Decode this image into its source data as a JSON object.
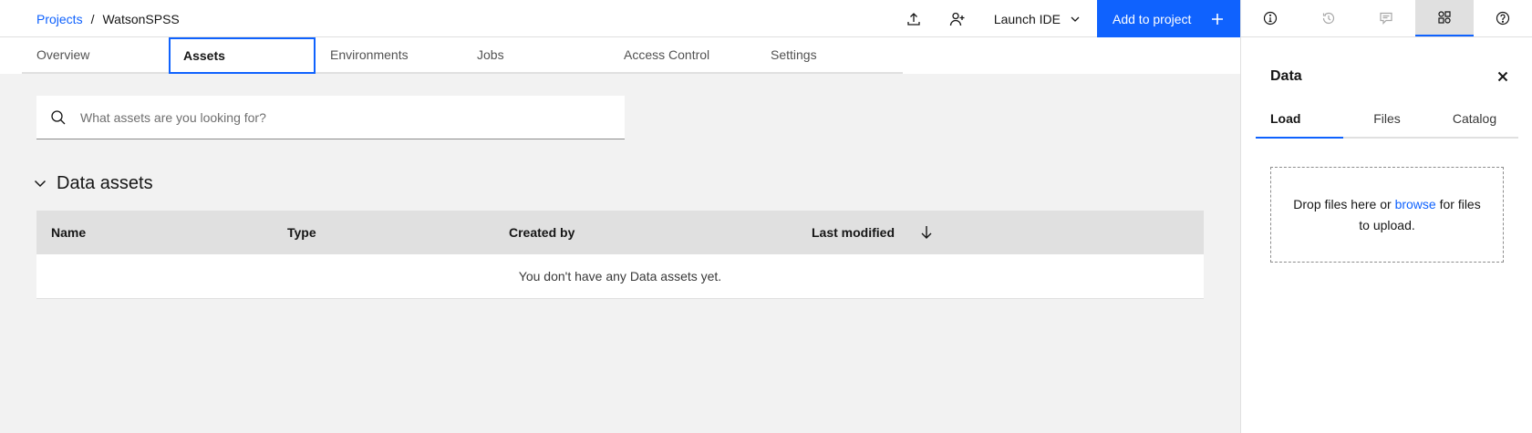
{
  "breadcrumb": {
    "root": "Projects",
    "separator": "/",
    "current": "WatsonSPSS"
  },
  "header": {
    "upload_icon": "upload-icon",
    "add_collaborator_icon": "add-user-icon",
    "launch_ide": "Launch IDE",
    "add_to_project": "Add to project"
  },
  "rail": [
    "info-icon",
    "history-icon",
    "comment-icon",
    "data-icon",
    "help-icon"
  ],
  "tabs": [
    "Overview",
    "Assets",
    "Environments",
    "Jobs",
    "Access Control",
    "Settings"
  ],
  "search": {
    "placeholder": "What assets are you looking for?"
  },
  "section": {
    "title": "Data assets"
  },
  "table": {
    "columns": [
      "Name",
      "Type",
      "Created by",
      "Last modified"
    ],
    "sort_icon": "arrow-down-icon",
    "empty_message": "You don't have any Data assets yet."
  },
  "panel": {
    "title": "Data",
    "tabs": [
      "Load",
      "Files",
      "Catalog"
    ],
    "drop_text_1": "Drop files here or ",
    "browse_link": "browse",
    "drop_text_2": " for files to upload."
  },
  "colors": {
    "accent": "#0f62fe",
    "background": "#f2f2f2",
    "header_row": "#e0e0e0"
  }
}
